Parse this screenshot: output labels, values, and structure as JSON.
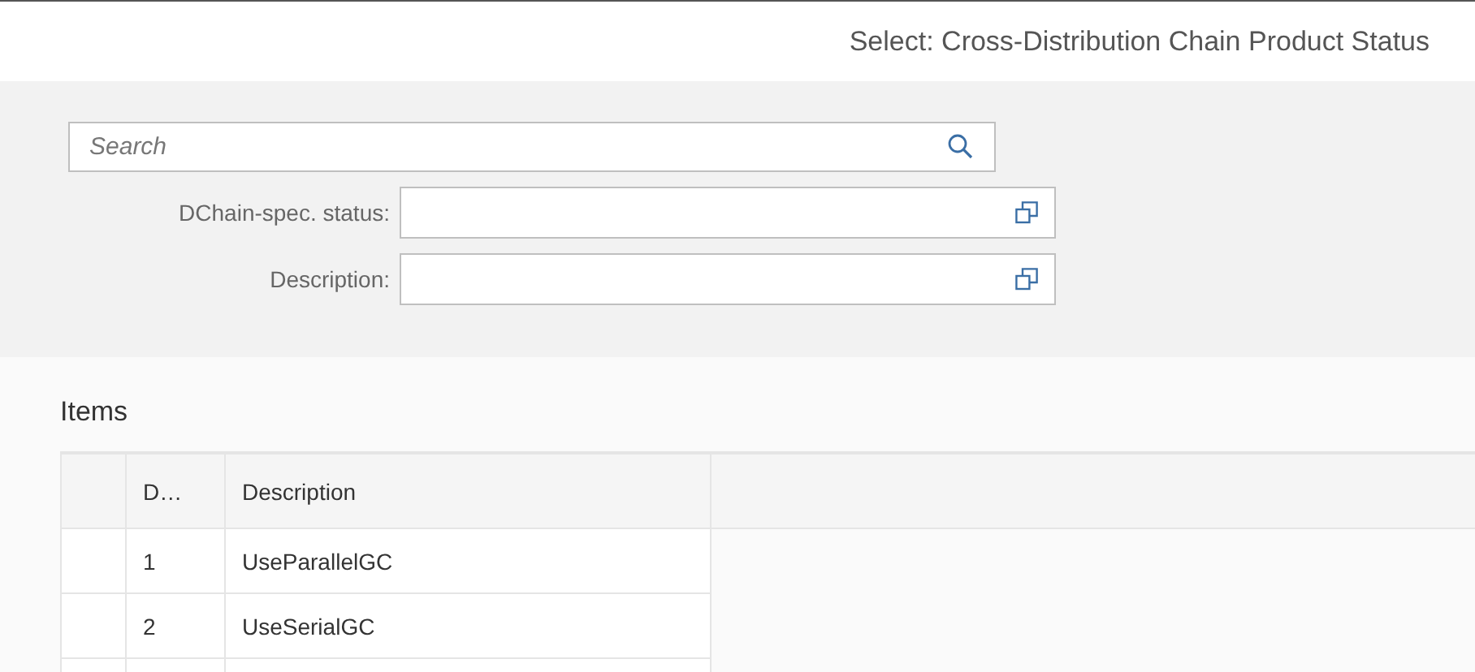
{
  "header": {
    "title": "Select: Cross-Distribution Chain Product Status"
  },
  "filter": {
    "search": {
      "placeholder": "Search"
    },
    "fields": [
      {
        "label": "DChain-spec. status:"
      },
      {
        "label": "Description:"
      }
    ]
  },
  "items": {
    "title": "Items",
    "columns": [
      "D…",
      "Description"
    ],
    "rows": [
      [
        "1",
        "UseParallelGC"
      ],
      [
        "2",
        "UseSerialGC"
      ]
    ]
  }
}
